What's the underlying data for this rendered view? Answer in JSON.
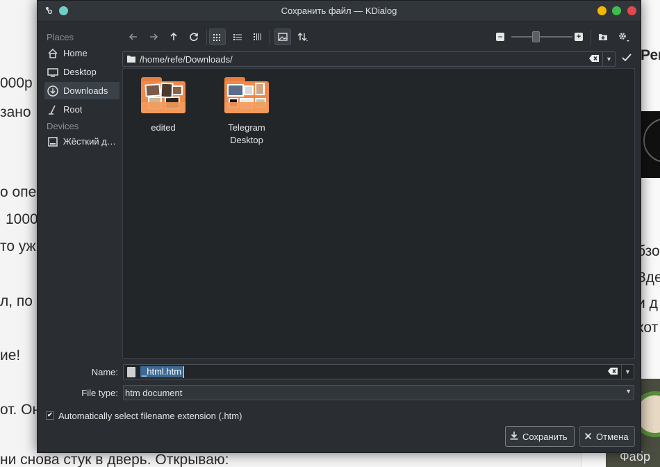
{
  "background_page": {
    "lines": [
      "000р",
      "зано",
      "о опе",
      "1000",
      "то уж",
      "л, по",
      "ие!",
      "от. Он",
      "ни снова стук в дверь. Открываю:"
    ],
    "sidebar_lines": [
      "Рем",
      "бзо",
      "Зде",
      "и д",
      "кот",
      "Фабр"
    ]
  },
  "window": {
    "title": "Сохранить файл — KDialog"
  },
  "places": {
    "section_places": "Places",
    "section_devices": "Devices",
    "items": [
      {
        "label": "Home",
        "icon": "home-icon"
      },
      {
        "label": "Desktop",
        "icon": "desktop-icon"
      },
      {
        "label": "Downloads",
        "icon": "downloads-icon",
        "active": true
      },
      {
        "label": "Root",
        "icon": "root-icon"
      }
    ],
    "devices": [
      {
        "label": "Жёсткий диск",
        "icon": "hard-drive-icon"
      }
    ]
  },
  "toolbar": {
    "back_icon": "back-arrow-icon",
    "forward_icon": "forward-arrow-icon",
    "up_icon": "up-arrow-icon",
    "reload_icon": "reload-icon",
    "view_icons": "icons-view-icon",
    "view_compact": "compact-view-icon",
    "view_details": "detail-view-icon",
    "preview": "preview-icon",
    "sort": "sort-icon",
    "zoom_out": "zoom-out-icon",
    "zoom_in": "zoom-in-icon",
    "new_folder": "new-folder-icon",
    "options": "options-gear-icon"
  },
  "location": {
    "path": "/home/refe/Downloads/"
  },
  "files": [
    {
      "name": "edited"
    },
    {
      "name": "Telegram\nDesktop"
    }
  ],
  "form": {
    "name_label": "Name:",
    "name_value": "_html.htm",
    "filetype_label": "File type:",
    "filetype_value": "htm document",
    "auto_ext_label": "Automatically select filename extension (.htm)",
    "auto_ext_checked": true
  },
  "buttons": {
    "save": "Сохранить",
    "cancel": "Отмена"
  },
  "colors": {
    "dialog_bg": "#2a2e32",
    "view_bg": "#232629",
    "selection": "#3d6a94",
    "folder": "#f08a4b"
  }
}
